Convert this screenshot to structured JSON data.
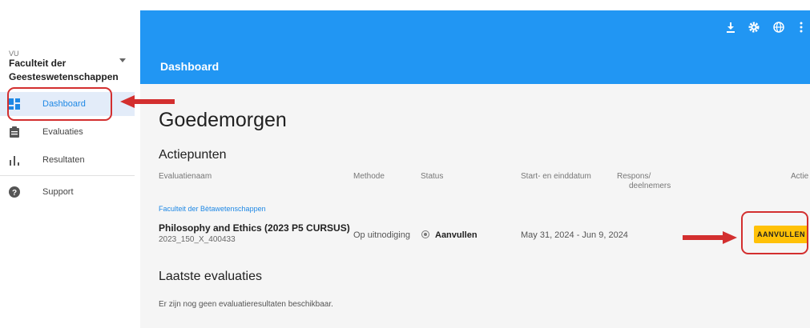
{
  "sidebar": {
    "org_small": "VU",
    "org_name": "Faculteit der Geesteswetenschappen",
    "items": [
      {
        "label": "Dashboard",
        "icon": "dashboard-icon",
        "active": true
      },
      {
        "label": "Evaluaties",
        "icon": "clipboard-icon",
        "active": false
      },
      {
        "label": "Resultaten",
        "icon": "bar-chart-icon",
        "active": false
      },
      {
        "label": "Support",
        "icon": "help-icon",
        "active": false
      }
    ]
  },
  "header": {
    "title": "Dashboard",
    "icons": [
      "download-icon",
      "gear-icon",
      "globe-icon",
      "more-icon"
    ],
    "color": "#2196f3"
  },
  "main": {
    "greeting": "Goedemorgen",
    "actions_title": "Actiepunten",
    "columns": {
      "name": "Evaluatienaam",
      "method": "Methode",
      "status": "Status",
      "dates": "Start- en einddatum",
      "response_line1": "Respons/",
      "response_line2": "deelnemers",
      "action": "Actie"
    },
    "faculty": "Faculteit der Bètawetenschappen",
    "row": {
      "course": "Philosophy and Ethics (2023 P5 CURSUS)",
      "code": "2023_150_X_400433",
      "method": "Op uitnodiging",
      "status": "Aanvullen",
      "dates": "May 31, 2024 - Jun 9, 2024",
      "button": "AANVULLEN"
    },
    "latest_title": "Laatste evaluaties",
    "empty": "Er zijn nog geen evaluatieresultaten beschikbaar."
  },
  "colors": {
    "accent": "#2196f3",
    "button": "#ffc107",
    "annotation": "#d32f2f",
    "link": "#1e88e5"
  }
}
